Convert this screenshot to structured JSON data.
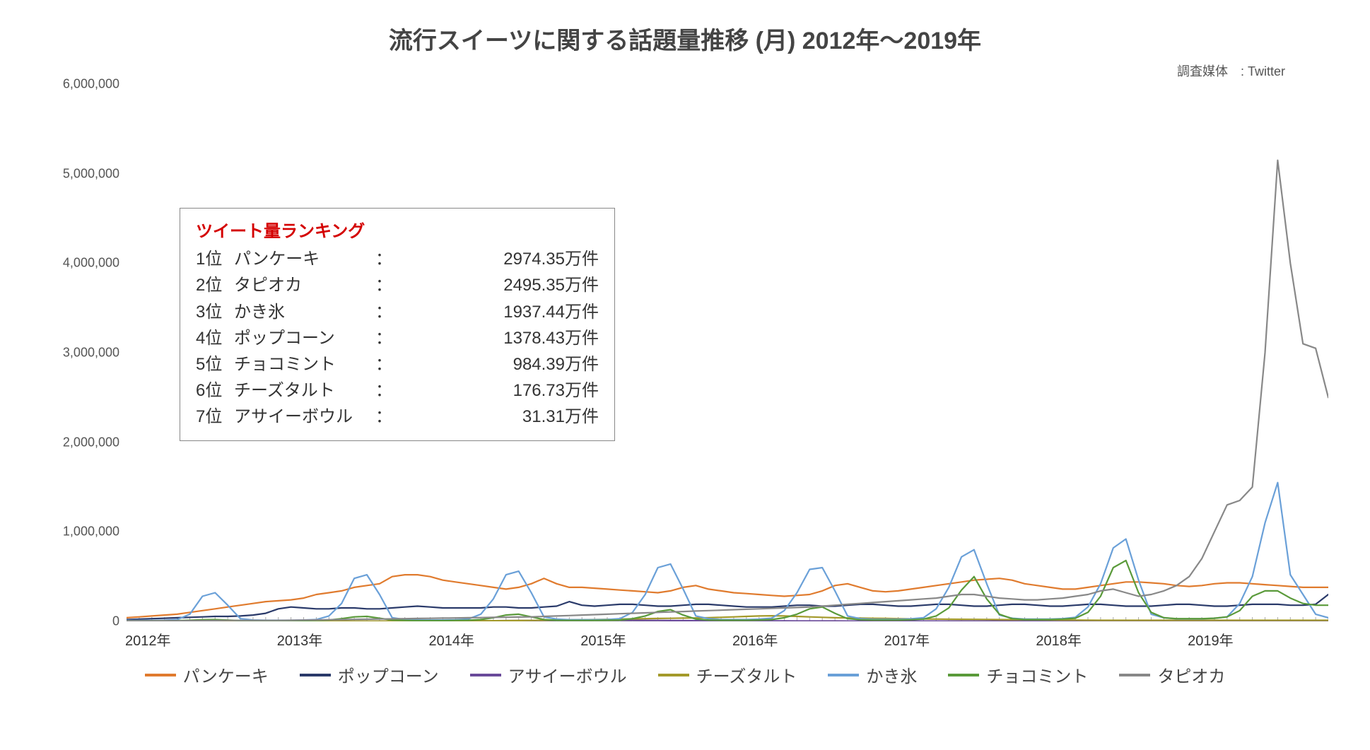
{
  "title": "流行スイーツに関する話題量推移 (月) 2012年～2019年",
  "subtitle": "調査媒体　: Twitter",
  "ranking": {
    "title": "ツイート量ランキング",
    "rows": [
      {
        "rank": "1位",
        "name": "パンケーキ",
        "value": "2974.35万件"
      },
      {
        "rank": "2位",
        "name": "タピオカ",
        "value": "2495.35万件"
      },
      {
        "rank": "3位",
        "name": "かき氷",
        "value": "1937.44万件"
      },
      {
        "rank": "4位",
        "name": "ポップコーン",
        "value": "1378.43万件"
      },
      {
        "rank": "5位",
        "name": "チョコミント",
        "value": " 984.39万件"
      },
      {
        "rank": "6位",
        "name": "チーズタルト",
        "value": " 176.73万件"
      },
      {
        "rank": "7位",
        "name": "アサイーボウル",
        "value": "  31.31万件"
      }
    ]
  },
  "legend": [
    {
      "name": "パンケーキ",
      "color": "#e07b2e"
    },
    {
      "name": "ポップコーン",
      "color": "#2a3a6a"
    },
    {
      "name": "アサイーボウル",
      "color": "#6a4a9a"
    },
    {
      "name": "チーズタルト",
      "color": "#a49a2a"
    },
    {
      "name": "かき氷",
      "color": "#6aa0d8"
    },
    {
      "name": "チョコミント",
      "color": "#5a9a3a"
    },
    {
      "name": "タピオカ",
      "color": "#888888"
    }
  ],
  "chart_data": {
    "type": "line",
    "title": "流行スイーツに関する話題量推移 (月) 2012年～2019年",
    "xlabel": "",
    "ylabel": "",
    "ylim": [
      0,
      6000000
    ],
    "yticks": [
      0,
      1000000,
      2000000,
      3000000,
      4000000,
      5000000,
      6000000
    ],
    "ytick_labels": [
      "0",
      "1,000,000",
      "2,000,000",
      "3,000,000",
      "4,000,000",
      "5,000,000",
      "6,000,000"
    ],
    "x_year_labels": [
      "2012年",
      "2013年",
      "2014年",
      "2015年",
      "2016年",
      "2017年",
      "2018年",
      "2019年"
    ],
    "x_months_count": 96,
    "series": [
      {
        "name": "パンケーキ",
        "color": "#e07b2e",
        "values": [
          40000,
          50000,
          60000,
          70000,
          80000,
          100000,
          120000,
          140000,
          160000,
          180000,
          200000,
          220000,
          230000,
          240000,
          260000,
          300000,
          320000,
          340000,
          380000,
          400000,
          420000,
          500000,
          520000,
          520000,
          500000,
          460000,
          440000,
          420000,
          400000,
          380000,
          360000,
          380000,
          420000,
          480000,
          420000,
          380000,
          380000,
          370000,
          360000,
          350000,
          340000,
          330000,
          320000,
          340000,
          380000,
          400000,
          360000,
          340000,
          320000,
          310000,
          300000,
          290000,
          280000,
          290000,
          300000,
          340000,
          400000,
          420000,
          380000,
          340000,
          330000,
          340000,
          360000,
          380000,
          400000,
          420000,
          440000,
          460000,
          470000,
          480000,
          460000,
          420000,
          400000,
          380000,
          360000,
          360000,
          380000,
          400000,
          420000,
          440000,
          440000,
          430000,
          420000,
          400000,
          390000,
          400000,
          420000,
          430000,
          430000,
          420000,
          410000,
          400000,
          390000,
          380000,
          380000,
          380000
        ]
      },
      {
        "name": "ポップコーン",
        "color": "#2a3a6a",
        "values": [
          20000,
          25000,
          30000,
          35000,
          40000,
          45000,
          50000,
          55000,
          55000,
          60000,
          70000,
          90000,
          140000,
          160000,
          150000,
          140000,
          140000,
          150000,
          150000,
          140000,
          140000,
          150000,
          160000,
          170000,
          160000,
          150000,
          150000,
          150000,
          150000,
          160000,
          160000,
          150000,
          150000,
          160000,
          170000,
          220000,
          180000,
          170000,
          180000,
          190000,
          190000,
          180000,
          170000,
          170000,
          180000,
          190000,
          190000,
          180000,
          170000,
          160000,
          160000,
          160000,
          170000,
          180000,
          180000,
          170000,
          170000,
          180000,
          190000,
          190000,
          180000,
          170000,
          170000,
          180000,
          190000,
          190000,
          180000,
          170000,
          170000,
          180000,
          190000,
          190000,
          180000,
          170000,
          170000,
          180000,
          190000,
          190000,
          180000,
          170000,
          170000,
          170000,
          180000,
          190000,
          190000,
          180000,
          170000,
          170000,
          180000,
          190000,
          190000,
          190000,
          180000,
          180000,
          190000,
          300000
        ]
      },
      {
        "name": "アサイーボウル",
        "color": "#6a4a9a",
        "values": [
          200,
          300,
          400,
          500,
          600,
          700,
          800,
          900,
          1000,
          1100,
          1200,
          1300,
          1400,
          1500,
          1600,
          1700,
          1800,
          1900,
          2000,
          2500,
          3000,
          3500,
          4000,
          4500,
          5000,
          5500,
          6000,
          6500,
          7000,
          7500,
          8000,
          8500,
          9000,
          9500,
          10000,
          10500,
          11000,
          11500,
          12000,
          12500,
          12000,
          11000,
          10000,
          9000,
          8000,
          7000,
          6500,
          6000,
          5500,
          5000,
          4800,
          4600,
          4400,
          4200,
          4000,
          3800,
          3600,
          3500,
          3400,
          3300,
          3200,
          3100,
          3000,
          2900,
          2800,
          2700,
          2600,
          2500,
          2400,
          2300,
          2200,
          2100,
          2000,
          1900,
          1800,
          1700,
          1600,
          1500,
          1400,
          1300,
          1200,
          1100,
          1000,
          900,
          800,
          700,
          600,
          500,
          400,
          400,
          400,
          400,
          400,
          400,
          400,
          400
        ]
      },
      {
        "name": "チーズタルト",
        "color": "#a49a2a",
        "values": [
          300,
          400,
          500,
          600,
          700,
          800,
          900,
          1000,
          1100,
          1200,
          1300,
          1400,
          1500,
          1600,
          1700,
          1800,
          1900,
          2000,
          2200,
          2400,
          2600,
          2800,
          3000,
          3500,
          4000,
          4500,
          5000,
          5500,
          6000,
          7000,
          8000,
          9000,
          10000,
          12000,
          14000,
          16000,
          18000,
          20000,
          22000,
          25000,
          28000,
          30000,
          32000,
          34000,
          36000,
          38000,
          40000,
          45000,
          50000,
          55000,
          60000,
          62000,
          60000,
          55000,
          50000,
          45000,
          40000,
          38000,
          36000,
          34000,
          32000,
          30000,
          28000,
          26000,
          25000,
          24000,
          23000,
          22000,
          21000,
          20000,
          19000,
          18000,
          17000,
          16000,
          15000,
          14000,
          13000,
          12000,
          12000,
          12000,
          12000,
          12000,
          12000,
          12000,
          12000,
          12000,
          12000,
          12000,
          12000,
          12000,
          12000,
          12000,
          12000,
          12000,
          12000,
          12000
        ]
      },
      {
        "name": "かき氷",
        "color": "#6aa0d8",
        "values": [
          10000,
          10000,
          10000,
          12000,
          20000,
          80000,
          280000,
          320000,
          180000,
          30000,
          15000,
          12000,
          12000,
          12000,
          15000,
          20000,
          60000,
          200000,
          480000,
          520000,
          300000,
          40000,
          20000,
          15000,
          15000,
          15000,
          18000,
          25000,
          80000,
          250000,
          520000,
          560000,
          320000,
          50000,
          25000,
          18000,
          18000,
          18000,
          20000,
          30000,
          100000,
          300000,
          600000,
          640000,
          360000,
          60000,
          30000,
          20000,
          20000,
          20000,
          25000,
          35000,
          120000,
          320000,
          580000,
          600000,
          340000,
          60000,
          30000,
          22000,
          22000,
          22000,
          28000,
          40000,
          140000,
          380000,
          720000,
          800000,
          420000,
          70000,
          35000,
          25000,
          25000,
          25000,
          30000,
          45000,
          160000,
          420000,
          820000,
          920000,
          460000,
          80000,
          40000,
          28000,
          28000,
          28000,
          35000,
          50000,
          200000,
          500000,
          1100000,
          1550000,
          520000,
          300000,
          80000,
          40000
        ]
      },
      {
        "name": "チョコミント",
        "color": "#5a9a3a",
        "values": [
          5000,
          5000,
          6000,
          7000,
          8000,
          12000,
          18000,
          20000,
          14000,
          8000,
          6000,
          6000,
          6000,
          7000,
          8000,
          10000,
          15000,
          30000,
          50000,
          55000,
          35000,
          15000,
          10000,
          8000,
          8000,
          8000,
          10000,
          12000,
          20000,
          40000,
          70000,
          80000,
          50000,
          20000,
          12000,
          10000,
          10000,
          10000,
          12000,
          15000,
          30000,
          60000,
          110000,
          130000,
          70000,
          25000,
          15000,
          12000,
          12000,
          12000,
          15000,
          20000,
          40000,
          80000,
          140000,
          160000,
          90000,
          30000,
          18000,
          14000,
          14000,
          14000,
          18000,
          25000,
          60000,
          150000,
          350000,
          500000,
          250000,
          80000,
          30000,
          20000,
          20000,
          20000,
          25000,
          35000,
          100000,
          280000,
          600000,
          680000,
          320000,
          100000,
          40000,
          30000,
          30000,
          30000,
          35000,
          50000,
          120000,
          280000,
          340000,
          340000,
          260000,
          200000,
          180000,
          180000
        ]
      },
      {
        "name": "タピオカ",
        "color": "#888888",
        "values": [
          5000,
          5000,
          5000,
          6000,
          6000,
          7000,
          8000,
          9000,
          10000,
          10000,
          10000,
          10000,
          10000,
          12000,
          14000,
          16000,
          18000,
          20000,
          22000,
          24000,
          26000,
          28000,
          30000,
          32000,
          34000,
          36000,
          38000,
          40000,
          42000,
          44000,
          46000,
          48000,
          50000,
          55000,
          60000,
          65000,
          70000,
          75000,
          80000,
          85000,
          90000,
          95000,
          100000,
          105000,
          110000,
          115000,
          120000,
          125000,
          130000,
          135000,
          140000,
          145000,
          150000,
          155000,
          160000,
          170000,
          180000,
          190000,
          200000,
          210000,
          220000,
          230000,
          240000,
          250000,
          260000,
          280000,
          300000,
          300000,
          280000,
          260000,
          250000,
          240000,
          240000,
          250000,
          260000,
          280000,
          300000,
          340000,
          360000,
          320000,
          280000,
          300000,
          340000,
          400000,
          500000,
          700000,
          1000000,
          1300000,
          1350000,
          1500000,
          3000000,
          5150000,
          4000000,
          3100000,
          3050000,
          2500000
        ]
      }
    ]
  }
}
